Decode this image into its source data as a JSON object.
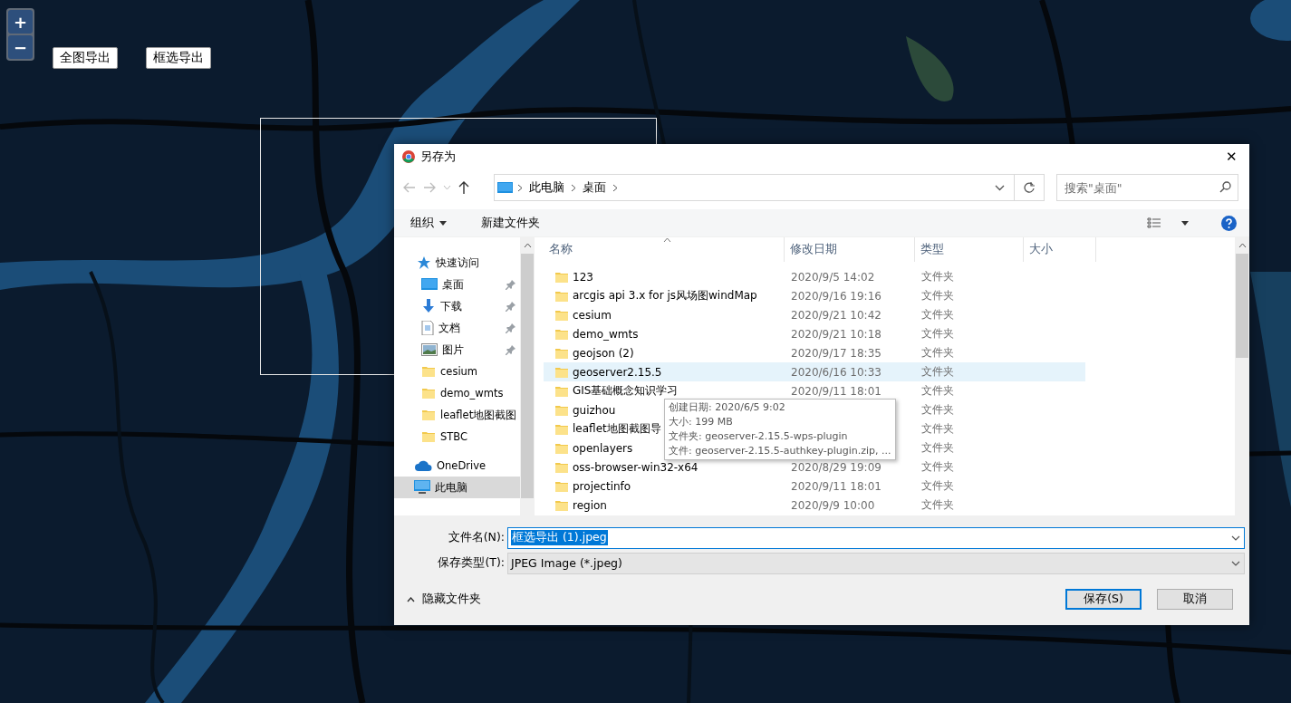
{
  "map": {
    "kind": "picture",
    "zoom_in": "+",
    "zoom_out": "−",
    "buttons": [
      "全图导出",
      "框选导出"
    ],
    "selection": true
  },
  "dialog": {
    "title": "另存为",
    "close": "✕",
    "address": {
      "crumbs": [
        "此电脑",
        "桌面"
      ]
    },
    "search": {
      "placeholder": "搜索\"桌面\""
    },
    "toolbar": {
      "organize": "组织",
      "new_folder": "新建文件夹"
    },
    "nav": [
      {
        "kind": "quick",
        "label": "快速访问",
        "selected": false
      },
      {
        "kind": "desktop",
        "label": "桌面",
        "pinned": true,
        "selected": false
      },
      {
        "kind": "download",
        "label": "下载",
        "pinned": true,
        "selected": false
      },
      {
        "kind": "document",
        "label": "文档",
        "pinned": true,
        "selected": false
      },
      {
        "kind": "pictures",
        "label": "图片",
        "pinned": true,
        "selected": false
      },
      {
        "kind": "folder",
        "label": "cesium",
        "selected": false
      },
      {
        "kind": "folder",
        "label": "demo_wmts",
        "selected": false
      },
      {
        "kind": "folder",
        "label": "leaflet地图截图",
        "selected": false
      },
      {
        "kind": "folder",
        "label": "STBC",
        "selected": false
      },
      {
        "kind": "cloud",
        "label": "OneDrive",
        "selected": false
      },
      {
        "kind": "pc",
        "label": "此电脑",
        "selected": true
      }
    ],
    "columns": [
      "名称",
      "修改日期",
      "类型",
      "大小"
    ],
    "files": [
      {
        "name": "123",
        "date": "2020/9/5 14:02",
        "type": "文件夹",
        "selected": false
      },
      {
        "name": "arcgis api 3.x for js风场图windMap",
        "date": "2020/9/16 19:16",
        "type": "文件夹",
        "selected": false
      },
      {
        "name": "cesium",
        "date": "2020/9/21 10:42",
        "type": "文件夹",
        "selected": false
      },
      {
        "name": "demo_wmts",
        "date": "2020/9/21 10:18",
        "type": "文件夹",
        "selected": false
      },
      {
        "name": "geojson (2)",
        "date": "2020/9/17 18:35",
        "type": "文件夹",
        "selected": false
      },
      {
        "name": "geoserver2.15.5",
        "date": "2020/6/16 10:33",
        "type": "文件夹",
        "selected": true
      },
      {
        "name": "GIS基础概念知识学习",
        "date": "2020/9/11 18:01",
        "type": "文件夹",
        "selected": false
      },
      {
        "name": "guizhou",
        "type": "文件夹",
        "selected": false
      },
      {
        "name": "leaflet地图截图导",
        "type": "文件夹",
        "selected": false
      },
      {
        "name": "openlayers",
        "type": "文件夹",
        "selected": false
      },
      {
        "name": "oss-browser-win32-x64",
        "date": "2020/8/29 19:09",
        "type": "文件夹",
        "selected": false
      },
      {
        "name": "projectinfo",
        "date": "2020/9/11 18:01",
        "type": "文件夹",
        "selected": false
      },
      {
        "name": "region",
        "date": "2020/9/9 10:00",
        "type": "文件夹",
        "selected": false
      }
    ],
    "tooltip": [
      "创建日期: 2020/6/5 9:02",
      "大小: 199 MB",
      "文件夹: geoserver-2.15.5-wps-plugin",
      "文件: geoserver-2.15.5-authkey-plugin.zip, ..."
    ],
    "filename": {
      "label": "文件名(N):",
      "value": "框选导出 (1).jpeg"
    },
    "filetype": {
      "label": "保存类型(T):",
      "value": "JPEG Image (*.jpeg)"
    },
    "hide_folders": "隐藏文件夹",
    "buttons": [
      {
        "label": "保存(S)",
        "default": true
      },
      {
        "label": "取消",
        "default": false
      }
    ]
  }
}
